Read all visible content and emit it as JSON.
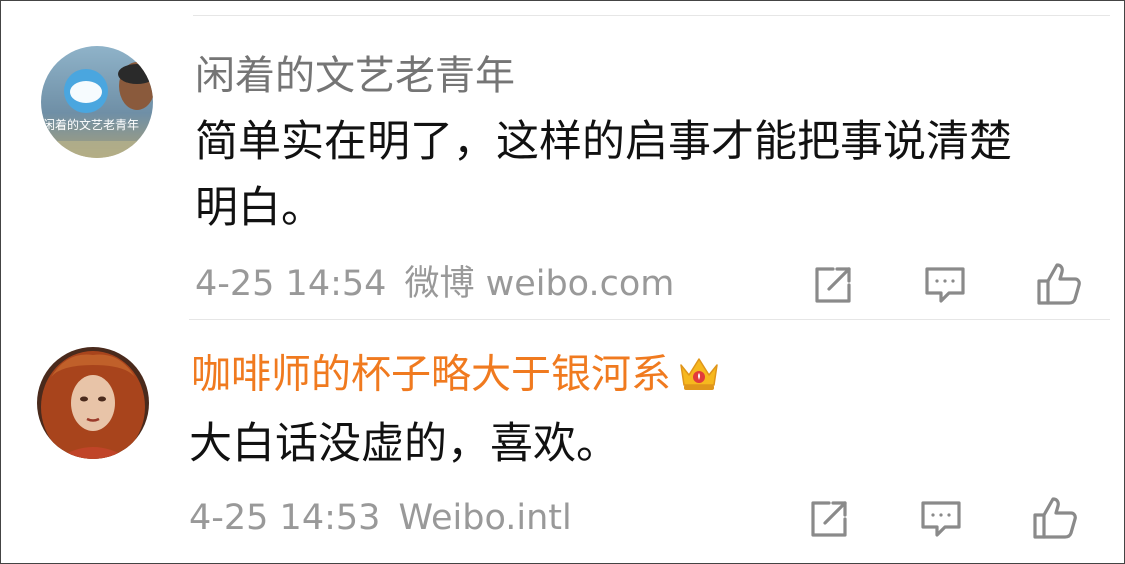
{
  "comments": [
    {
      "username": "闲着的文艺老青年",
      "username_color": "#757575",
      "text_line1": "简单实在明了，这样的启事才能把事说清楚",
      "text_line2": "明白。",
      "time": "4-25 14:54",
      "source": "微博 weibo.com",
      "avatar_text": "闲着的文艺老青年",
      "has_crown": false
    },
    {
      "username": "咖啡师的杯子略大于银河系",
      "username_color": "#f07a1f",
      "text_line1": "大白话没虚的，喜欢。",
      "time": "4-25 14:53",
      "source": "Weibo.intl",
      "has_crown": true
    }
  ],
  "icons": {
    "share": "share-icon",
    "comment": "comment-icon",
    "like": "thumbs-up-icon",
    "crown": "crown-icon"
  },
  "colors": {
    "meta_gray": "#999999",
    "icon_gray": "#8a8a8a",
    "vip_orange": "#f07a1f",
    "divider": "#e6e6e6"
  }
}
